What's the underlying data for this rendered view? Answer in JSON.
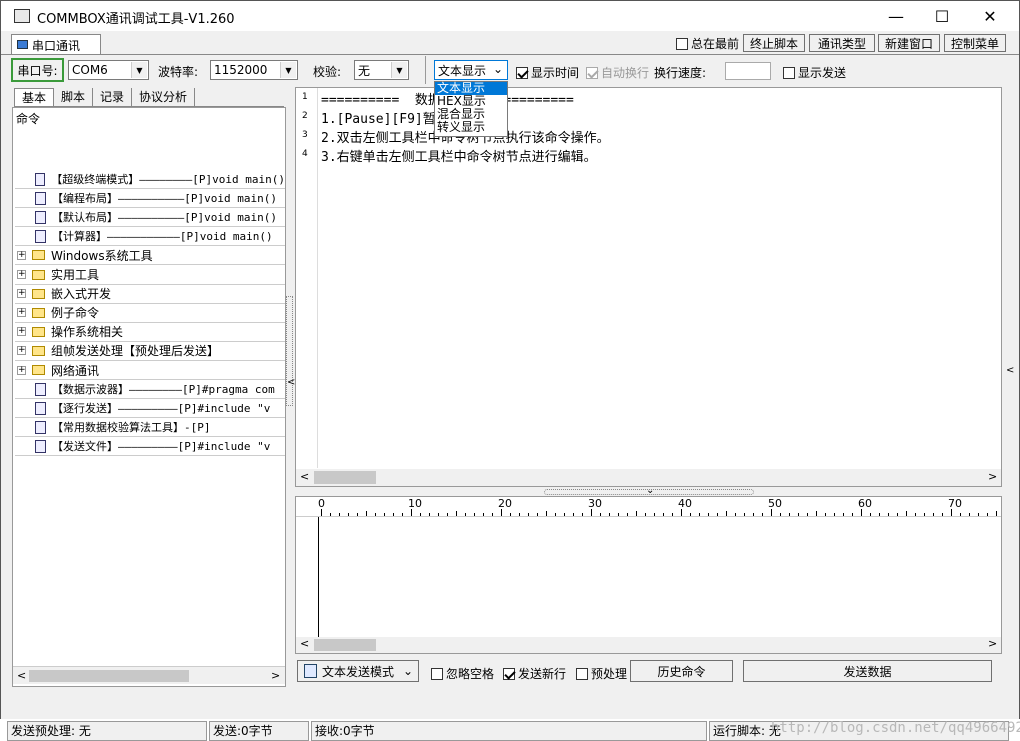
{
  "window": {
    "title": "COMMBOX通讯调试工具-V1.260",
    "minimize": "—",
    "maximize": "☐",
    "close": "✕"
  },
  "tab": {
    "label": "串口通讯"
  },
  "top_right": {
    "always_on_top": "总在最前",
    "stop_script": "终止脚本",
    "comm_type": "通讯类型",
    "new_window": "新建窗口",
    "control_menu": "控制菜单"
  },
  "toolbar": {
    "port_label": "串口号:",
    "port_value": "COM6",
    "baud_label": "波特率:",
    "baud_value": "1152000",
    "parity_label": "校验:",
    "parity_value": "无",
    "display_mode": "文本显示",
    "show_time": "显示时间",
    "auto_wrap": "自动换行",
    "wrap_speed": "换行速度:",
    "show_send": "显示发送"
  },
  "dropdown": {
    "options": [
      "文本显示",
      "HEX显示",
      "混合显示",
      "转义显示"
    ]
  },
  "left_tabs": [
    "基本",
    "脚本",
    "记录",
    "协议分析"
  ],
  "tree": {
    "root": "命令",
    "items": [
      {
        "type": "doc",
        "text": "【超级终端模式】————————[P]void main()"
      },
      {
        "type": "doc",
        "text": "【编程布局】——————————[P]void main()"
      },
      {
        "type": "doc",
        "text": "【默认布局】——————————[P]void main()"
      },
      {
        "type": "doc",
        "text": "【计算器】———————————[P]void main()"
      },
      {
        "type": "folder",
        "text": "Windows系统工具"
      },
      {
        "type": "folder",
        "text": "实用工具"
      },
      {
        "type": "folder",
        "text": "嵌入式开发"
      },
      {
        "type": "folder",
        "text": "例子命令"
      },
      {
        "type": "folder",
        "text": "操作系统相关"
      },
      {
        "type": "folder",
        "text": "组帧发送处理【预处理后发送】"
      },
      {
        "type": "folder",
        "text": "网络通讯"
      },
      {
        "type": "doc",
        "text": "【数据示波器】————————[P]#pragma com"
      },
      {
        "type": "doc",
        "text": "【逐行发送】—————————[P]#include \"v"
      },
      {
        "type": "doc",
        "text": "【常用数据校验算法工具】-[P]"
      },
      {
        "type": "doc",
        "text": "【发送文件】—————————[P]#include \"v"
      }
    ]
  },
  "editor": {
    "line_numbers": [
      "1",
      "2",
      "3",
      "4"
    ],
    "lines": [
      "==========  数据接收区  ==========",
      "1.[Pause][F9]暂停接收显示。",
      "2.双击左侧工具栏中命令树节点执行该命令操作。",
      "3.右键单击左侧工具栏中命令树节点进行编辑。"
    ]
  },
  "ruler": {
    "labels": [
      "0",
      "10",
      "20",
      "30",
      "40",
      "50",
      "60",
      "70"
    ]
  },
  "bottom": {
    "send_mode": "文本发送模式",
    "ignore_space": "忽略空格",
    "send_newline": "发送新行",
    "preprocess": "预处理",
    "history": "历史命令",
    "send_data": "发送数据"
  },
  "status": {
    "preprocess": "发送预处理: 无",
    "sent": "发送:0字节",
    "received": "接收:0字节",
    "watermark": "http://blog.csdn.net/qq496649247",
    "script": "运行脚本: 无"
  }
}
